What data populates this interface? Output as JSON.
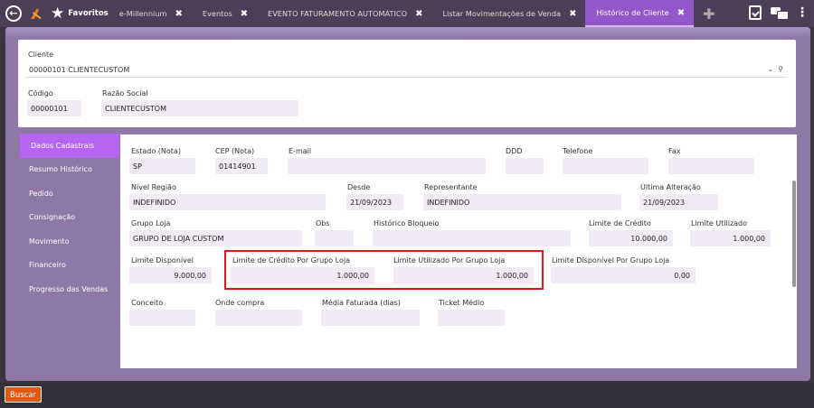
{
  "tabbar": {
    "favorites_label": "Favoritos",
    "tabs": [
      {
        "label": "e-Millennium",
        "close": "✖"
      },
      {
        "label": "Eventos",
        "close": "✖"
      },
      {
        "label": "EVENTO FATURAMENTO AUTOMÁTICO",
        "close": "✖"
      },
      {
        "label": "Listar Movimentações de Venda",
        "close": "✖"
      },
      {
        "label": "Histórico de Cliente",
        "close": "✖"
      }
    ],
    "add_icon": "plus-icon"
  },
  "header": {
    "cliente_label": "Cliente",
    "cliente_value": "00000101 CLIENTECUSTOM",
    "codigo_label": "Código",
    "codigo_value": "00000101",
    "razao_label": "Razão Social",
    "razao_value": "CLIENTECUSTOM"
  },
  "sidebar": {
    "items": [
      {
        "label": "Dados Cadastrais"
      },
      {
        "label": "Resumo Histórico"
      },
      {
        "label": "Pedido"
      },
      {
        "label": "Consignação"
      },
      {
        "label": "Movimento"
      },
      {
        "label": "Financeiro"
      },
      {
        "label": "Progresso das Vendas"
      }
    ]
  },
  "form": {
    "estado_label": "Estado (Nota)",
    "estado_value": "SP",
    "cep_label": "CEP (Nota)",
    "cep_value": "01414901",
    "email_label": "E-mail",
    "email_value": "",
    "ddd_label": "DDD",
    "ddd_value": "",
    "telefone_label": "Telefone",
    "telefone_value": "",
    "fax_label": "Fax",
    "fax_value": "",
    "nivel_label": "Nível Região",
    "nivel_value": "INDEFINIDO",
    "desde_label": "Desde",
    "desde_value": "21/09/2023",
    "representante_label": "Representante",
    "representante_value": "INDEFINIDO",
    "ultima_label": "Última Alteração",
    "ultima_value": "21/09/2023",
    "grupo_label": "Grupo Loja",
    "grupo_value": "GRUPO DE LOJA CUSTOM",
    "obs_label": "Obs",
    "obs_value": "",
    "historico_label": "Histórico Bloqueio",
    "historico_value": "",
    "limite_credito_label": "Limite de Crédito",
    "limite_credito_value": "10.000,00",
    "limite_utilizado_label": "Limite Utilizado",
    "limite_utilizado_value": "1.000,00",
    "limite_disponivel_label": "Limite Disponível",
    "limite_disponivel_value": "9.000,00",
    "lc_grupo_label": "Limite de Crédito Por Grupo Loja",
    "lc_grupo_value": "1.000,00",
    "lu_grupo_label": "Limite Utilizado Por Grupo Loja",
    "lu_grupo_value": "1.000,00",
    "ld_grupo_label": "Limite Disponível Por Grupo Loja",
    "ld_grupo_value": "0,00",
    "conceito_label": "Conceito",
    "conceito_value": "",
    "onde_label": "Onde compra",
    "onde_value": "",
    "media_label": "Média Faturada (dias)",
    "media_value": "",
    "ticket_label": "Ticket Médio",
    "ticket_value": ""
  },
  "footer": {
    "buscar_label": "Buscar"
  },
  "colors": {
    "accent": "#9257c9",
    "highlight": "#e01818",
    "button": "#e05a16"
  }
}
